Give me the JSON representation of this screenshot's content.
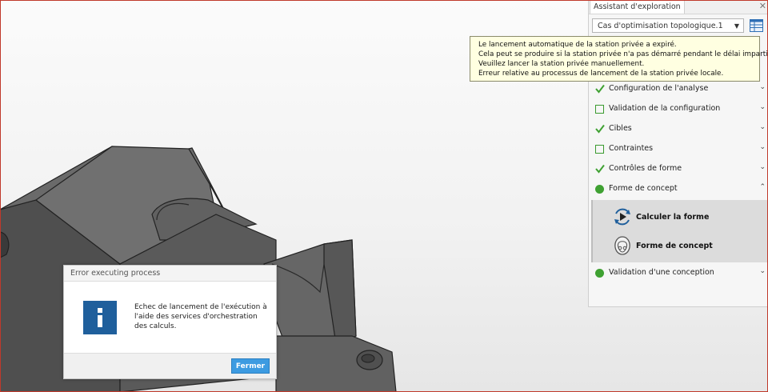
{
  "panel": {
    "title": "Assistant d'exploration",
    "close": "✕",
    "case_select": "Cas d'optimisation topologique.1",
    "steps": [
      {
        "label": "Configuration de l'analyse",
        "status": "check"
      },
      {
        "label": "Validation de la configuration",
        "status": "box"
      },
      {
        "label": "Cibles",
        "status": "check"
      },
      {
        "label": "Contraintes",
        "status": "box"
      },
      {
        "label": "Contrôles de forme",
        "status": "check"
      },
      {
        "label": "Forme de concept",
        "status": "dot",
        "expanded": true
      },
      {
        "label": "Validation d'une conception",
        "status": "dot"
      }
    ],
    "sub_items": [
      {
        "label": "Calculer la forme",
        "icon": "compute-shape-icon"
      },
      {
        "label": "Forme de concept",
        "icon": "concept-shape-icon"
      }
    ]
  },
  "tooltip": {
    "lines": [
      "Le lancement automatique de la station privée a expiré.",
      "Cela peut se produire si la station privée n'a pas démarré pendant le délai imparti.",
      "Veuillez lancer la station privée manuellement.",
      "Erreur relative au processus de lancement de la station privée locale."
    ]
  },
  "dialog": {
    "title": "Error executing process",
    "icon": "info-icon",
    "message_lines": [
      "Echec de lancement de l'exécution à",
      "l'aide des services d'orchestration",
      "des calculs."
    ],
    "close_label": "Fermer"
  },
  "colors": {
    "check": "#3fa132",
    "info_icon_bg": "#1f5f9c",
    "button": "#3d9be1",
    "tooltip_bg": "#ffffe1",
    "part": "#5f5f5f"
  }
}
